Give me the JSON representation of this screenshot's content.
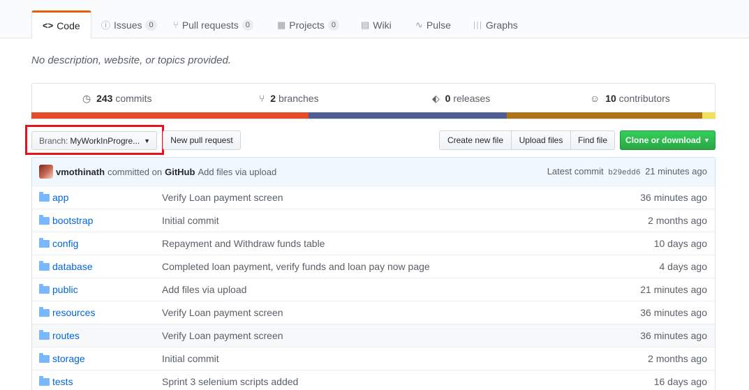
{
  "tabs": [
    {
      "label": "Code",
      "icon": "code-icon",
      "glyph": "<>",
      "selected": true
    },
    {
      "label": "Issues",
      "icon": "issue-icon",
      "glyph": "ⓘ",
      "count": "0"
    },
    {
      "label": "Pull requests",
      "icon": "pull-request-icon",
      "glyph": "⑂",
      "count": "0"
    },
    {
      "label": "Projects",
      "icon": "project-icon",
      "glyph": "▦",
      "count": "0"
    },
    {
      "label": "Wiki",
      "icon": "book-icon",
      "glyph": "▤"
    },
    {
      "label": "Pulse",
      "icon": "pulse-icon",
      "glyph": "∿"
    },
    {
      "label": "Graphs",
      "icon": "graph-icon",
      "glyph": "│││"
    }
  ],
  "description": "No description, website, or topics provided.",
  "summary": {
    "commits_count": "243",
    "commits_label": "commits",
    "branches_count": "2",
    "branches_label": "branches",
    "releases_count": "0",
    "releases_label": "releases",
    "contributors_count": "10",
    "contributors_label": "contributors"
  },
  "language_bar": [
    {
      "color": "#e34c26",
      "share": 40.5
    },
    {
      "color": "#4f5d95",
      "share": 29.0
    },
    {
      "color": "#b07219",
      "share": 28.6
    },
    {
      "color": "#f1e05a",
      "share": 1.9
    }
  ],
  "toolbar": {
    "branch_label": "Branch:",
    "branch_value": "MyWorkInProgre...",
    "new_pull_request": "New pull request",
    "create_new_file": "Create new file",
    "upload_files": "Upload files",
    "find_file": "Find file",
    "clone_or_download": "Clone or download"
  },
  "latest_commit": {
    "author": "vmothinath",
    "committed_on": "committed on",
    "platform": "GitHub",
    "message": "Add files via upload",
    "prefix": "Latest commit",
    "sha": "b29edd6",
    "age": "21 minutes ago"
  },
  "files": [
    {
      "name": "app",
      "message": "Verify Loan payment screen",
      "age": "36 minutes ago"
    },
    {
      "name": "bootstrap",
      "message": "Initial commit",
      "age": "2 months ago"
    },
    {
      "name": "config",
      "message": "Repayment and Withdraw funds table",
      "age": "10 days ago"
    },
    {
      "name": "database",
      "message": "Completed loan payment, verify funds and loan pay now page",
      "age": "4 days ago"
    },
    {
      "name": "public",
      "message": "Add files via upload",
      "age": "21 minutes ago"
    },
    {
      "name": "resources",
      "message": "Verify Loan payment screen",
      "age": "36 minutes ago"
    },
    {
      "name": "routes",
      "message": "Verify Loan payment screen",
      "age": "36 minutes ago"
    },
    {
      "name": "storage",
      "message": "Initial commit",
      "age": "2 months ago"
    },
    {
      "name": "tests",
      "message": "Sprint 3 selenium scripts added",
      "age": "16 days ago"
    }
  ]
}
